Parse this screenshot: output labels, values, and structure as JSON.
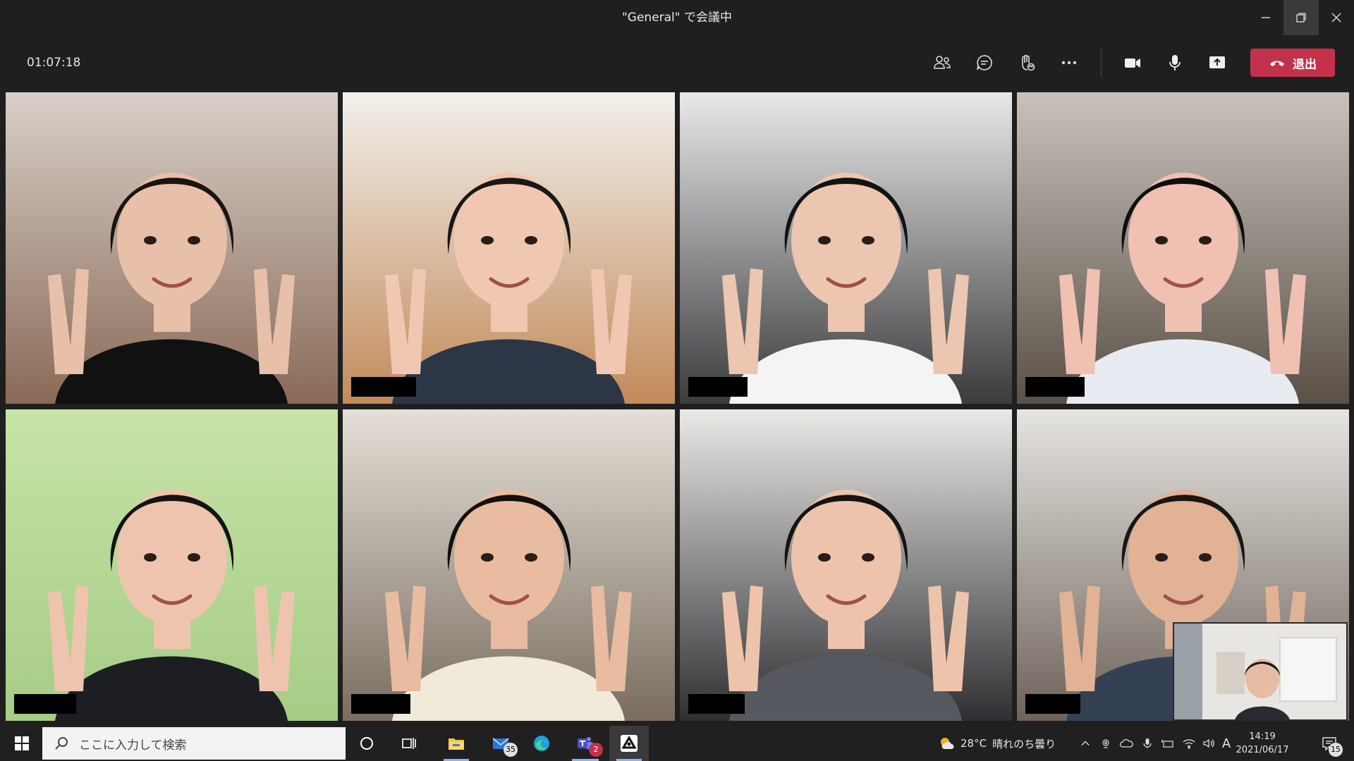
{
  "window": {
    "title": "\"General\" で会議中"
  },
  "toolbar": {
    "timer": "01:07:18",
    "leave_label": "退出"
  },
  "taskbar": {
    "search_placeholder": "ここに入力して検索",
    "mail_badge": "35",
    "teams_badge": "2",
    "weather_temp": "28°C",
    "weather_desc": "晴れのち曇り",
    "ime_indicator": "A",
    "time": "14:19",
    "date": "2021/06/17",
    "notification_count": "15"
  },
  "participants": [
    {
      "tile": 1,
      "bg": [
        "#d8cfc8",
        "#8a6a58"
      ],
      "shirt": "#111111",
      "skin": "#e8bfa8",
      "hair": "#1a1412"
    },
    {
      "tile": 2,
      "bg": [
        "#f2f0ec",
        "#c28a5a"
      ],
      "shirt": "#2c3646",
      "skin": "#f0c8b2",
      "hair": "#1c1714"
    },
    {
      "tile": 3,
      "bg": [
        "#e9e9ea",
        "#3b3b3d"
      ],
      "shirt": "#f4f4f4",
      "skin": "#ecc6b0",
      "hair": "#141212"
    },
    {
      "tile": 4,
      "bg": [
        "#c9c2ba",
        "#5a5048"
      ],
      "shirt": "#e8ecf2",
      "skin": "#f0c0b2",
      "hair": "#100e0e"
    },
    {
      "tile": 5,
      "bg": [
        "#c6e3a8",
        "#a6cc86"
      ],
      "shirt": "#1c1e24",
      "skin": "#eec4ae",
      "hair": "#151212"
    },
    {
      "tile": 6,
      "bg": [
        "#e4dfd7",
        "#7a6d60"
      ],
      "shirt": "#f2ead8",
      "skin": "#e9bba0",
      "hair": "#120f0e"
    },
    {
      "tile": 7,
      "bg": [
        "#ebe9e6",
        "#2f2f33"
      ],
      "shirt": "#55595f",
      "skin": "#eec3ac",
      "hair": "#161312"
    },
    {
      "tile": 8,
      "bg": [
        "#e6e4e0",
        "#6e625a"
      ],
      "shirt": "#344054",
      "skin": "#e2b294",
      "hair": "#1a1614"
    }
  ],
  "colors": {
    "active_speaker_outline": "#9ea2ff",
    "leave_button": "#c4314b",
    "chrome_bg": "#1f1f1f"
  }
}
